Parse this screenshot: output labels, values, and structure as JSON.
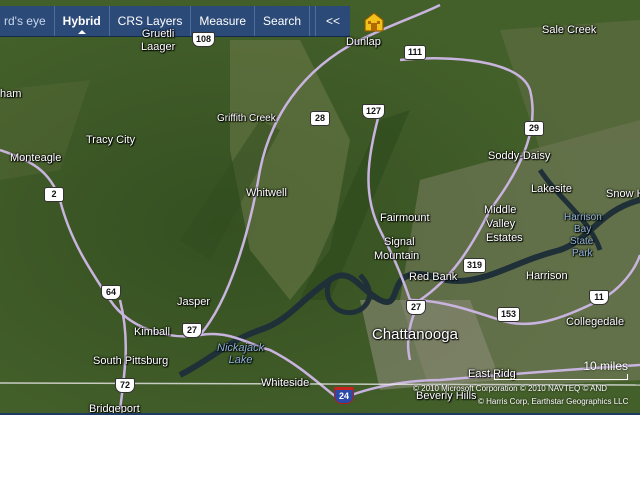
{
  "toolbar": {
    "items": [
      "rd's eye",
      "Hybrid",
      "CRS Layers",
      "Measure",
      "Search"
    ],
    "collapse": "<<"
  },
  "places": {
    "gruetli_laager": "Gruetli\nLaager",
    "dunlap": "Dunlap",
    "sale_creek": "Sale Creek",
    "tracy_city": "Tracy City",
    "griffith_creek": "Griffith Creek",
    "monteagle": "Monteagle",
    "whitwell": "Whitwell",
    "soddy_daisy": "Soddy-Daisy",
    "lakesite": "Lakesite",
    "snow_hill": "Snow H",
    "fairmount": "Fairmount",
    "middle_valley": "Middle",
    "middle_valley2": "Valley",
    "estates": "Estates",
    "harrison_bay": "Harrison",
    "bay": "Bay",
    "state": "State",
    "park": "Park",
    "signal": "Signal",
    "mountain": "Mountain",
    "red_bank": "Red Bank",
    "harrison": "Harrison",
    "jasper": "Jasper",
    "kimball": "Kimball",
    "chattanooga": "Chattanooga",
    "collegedale": "Collegedale",
    "south_pittsburg": "South Pittsburg",
    "nickajack_lake": "Nickajack\nLake",
    "whiteside": "Whiteside",
    "east_ridge": "East Ridg",
    "beverly_hills": "Beverly Hills",
    "bridgeport": "Bridgeport",
    "ham": "ham"
  },
  "shields": {
    "r108": "108",
    "r111": "111",
    "r28": "28",
    "r127": "127",
    "r29": "29",
    "r2": "2",
    "r64": "64",
    "r319": "319",
    "r27a": "27",
    "r27b": "27",
    "r153": "153",
    "r11": "11",
    "r72": "72",
    "i24": "24"
  },
  "scale": {
    "label": "10 miles"
  },
  "copyright": {
    "line1": "© 2010 Microsoft Corporation   © 2010 NAVTEQ   © AND",
    "line2": "© Harris Corp, Earthstar Geographics LLC"
  },
  "colors": {
    "terrain": "#3f5a26",
    "road": "#c9b4e0",
    "water": "#1f3038",
    "toolbar": "#2c4a78"
  }
}
